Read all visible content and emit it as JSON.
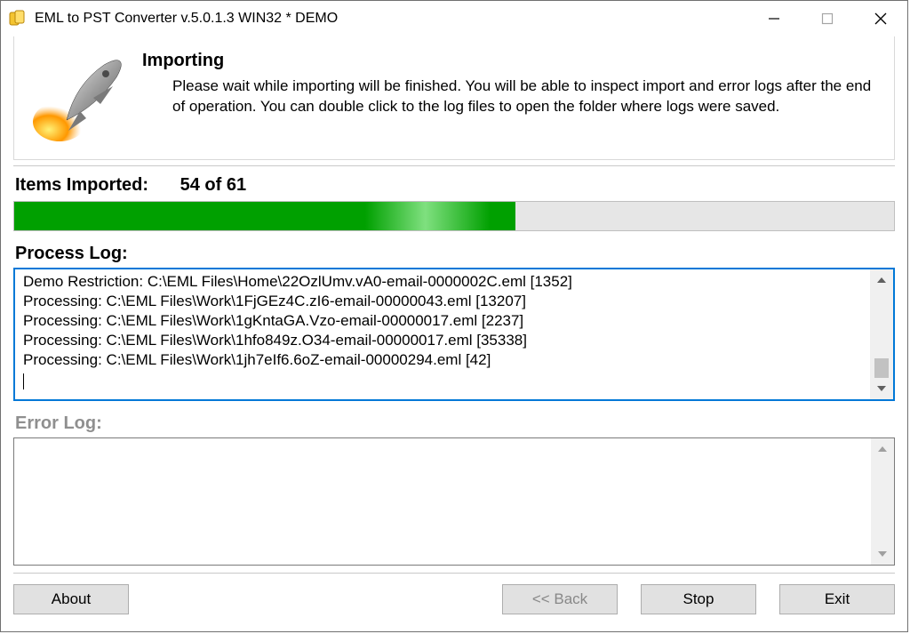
{
  "window": {
    "title": "EML to PST Converter v.5.0.1.3 WIN32 * DEMO"
  },
  "header": {
    "title": "Importing",
    "description": "Please wait while importing will be finished. You will be able to inspect import and error logs after the end of operation. You can double click to the log files to open the folder where logs were saved."
  },
  "status": {
    "label": "Items Imported:",
    "count_text": "54 of 61",
    "percent": 57
  },
  "process_log": {
    "label": "Process Log:",
    "lines": [
      "Demo Restriction: C:\\EML Files\\Home\\22OzlUmv.vA0-email-0000002C.eml [1352]",
      "Processing: C:\\EML Files\\Work\\1FjGEz4C.zI6-email-00000043.eml [13207]",
      "Processing: C:\\EML Files\\Work\\1gKntaGA.Vzo-email-00000017.eml [2237]",
      "Processing: C:\\EML Files\\Work\\1hfo849z.O34-email-00000017.eml [35338]",
      "Processing: C:\\EML Files\\Work\\1jh7eIf6.6oZ-email-00000294.eml [42]"
    ]
  },
  "error_log": {
    "label": "Error Log:",
    "lines": []
  },
  "buttons": {
    "about": "About",
    "back": "<< Back",
    "stop": "Stop",
    "exit": "Exit"
  }
}
